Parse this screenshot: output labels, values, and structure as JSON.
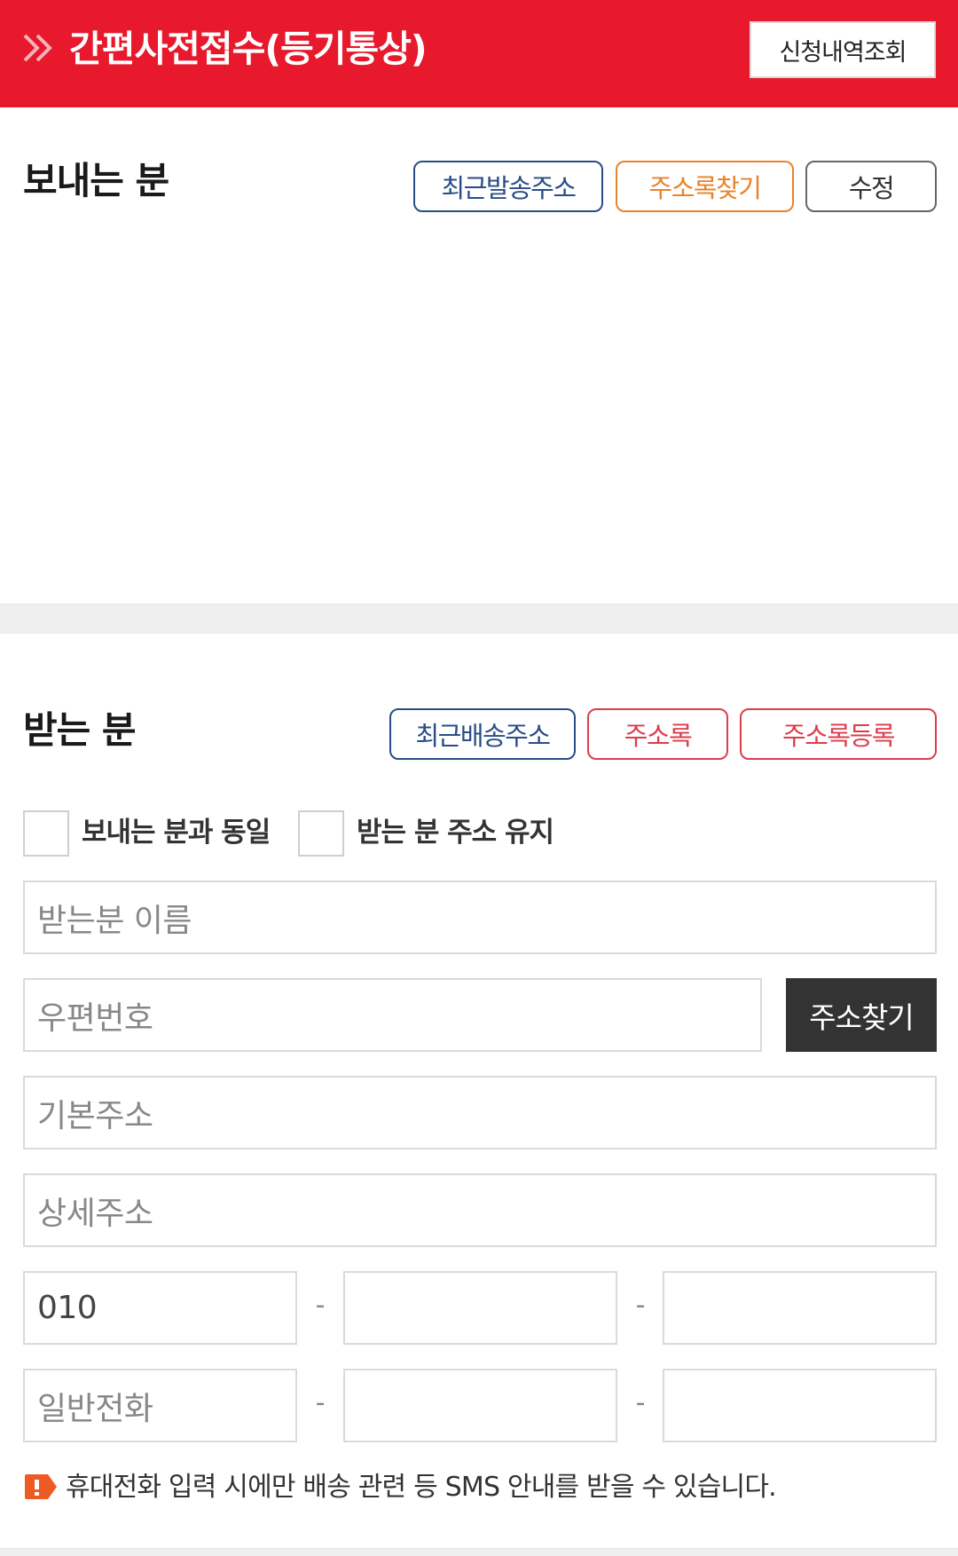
{
  "header": {
    "title": "간편사전접수(등기통상)",
    "history_button": "신청내역조회",
    "accent_color": "#e8192c"
  },
  "sender": {
    "heading": "보내는 분",
    "buttons": {
      "recent": "최근발송주소",
      "address_book": "주소록찾기",
      "edit": "수정"
    }
  },
  "receiver": {
    "heading": "받는 분",
    "buttons": {
      "recent": "최근배송주소",
      "address_book": "주소록",
      "register": "주소록등록"
    },
    "checkboxes": {
      "same_as_sender": "보내는 분과 동일",
      "keep_address": "받는 분 주소 유지"
    },
    "fields": {
      "name_placeholder": "받는분 이름",
      "postcode_placeholder": "우편번호",
      "search_button": "주소찾기",
      "base_address_placeholder": "기본주소",
      "detail_address_placeholder": "상세주소",
      "mobile_prefix": "010",
      "phone_placeholder": "일반전화",
      "separator": "-"
    }
  },
  "notice": {
    "icon": "alert-tag-icon",
    "text": "휴대전화 입력 시에만 배송 관련 등 SMS 안내를 받을 수 있습니다."
  }
}
